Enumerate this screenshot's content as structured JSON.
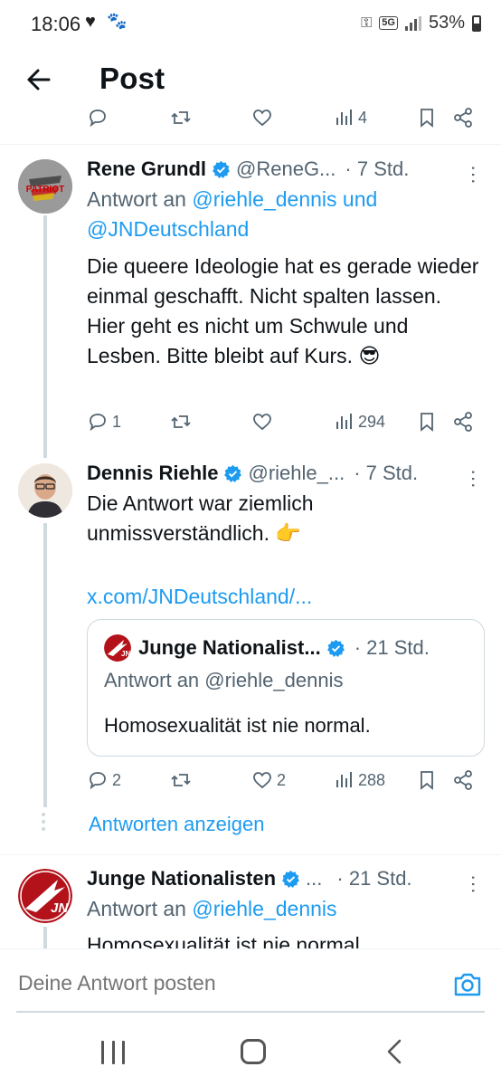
{
  "status_bar": {
    "time": "18:06",
    "heart_icon": "heart",
    "paw_icon": "paw",
    "network": "5G",
    "battery": "53%"
  },
  "header": {
    "title": "Post"
  },
  "top_partial_actions": {
    "views": "4"
  },
  "tweets": [
    {
      "name": "Rene Grundl",
      "handle": "@ReneG...",
      "time": "· 7 Std.",
      "reply_prefix": "Antwort an ",
      "reply_to": "@riehle_dennis und @JNDeutschland",
      "body": "Die queere Ideologie hat es gerade wieder einmal geschafft. Nicht spalten lassen. Hier geht es nicht um Schwule und Lesben. Bitte bleibt auf Kurs. 😎",
      "avatar_label": "PATRIOT",
      "replies": "1",
      "retweets": "",
      "likes": "",
      "views": "294"
    },
    {
      "name": "Dennis Riehle",
      "handle": "@riehle_...",
      "time": "· 7 Std.",
      "body": "Die Antwort war ziemlich unmissverständlich. 👉",
      "link": "x.com/JNDeutschland/...",
      "quote": {
        "name": "Junge Nationalist...",
        "time": "· 21 Std.",
        "reply": "Antwort an @riehle_dennis",
        "body": "Homosexualität ist nie normal."
      },
      "replies": "2",
      "retweets": "",
      "likes": "2",
      "views": "288",
      "show_replies": "Antworten anzeigen"
    },
    {
      "name": "Junge Nationalisten",
      "handle": "...",
      "time": "· 21 Std.",
      "reply_prefix": "Antwort an ",
      "reply_to": "@riehle_dennis",
      "body": "Homosexualität ist nie normal."
    }
  ],
  "composer": {
    "placeholder": "Deine Antwort posten"
  },
  "colors": {
    "accent": "#1d9bf0",
    "secondary_text": "#536471",
    "primary_text": "#0f1419"
  }
}
